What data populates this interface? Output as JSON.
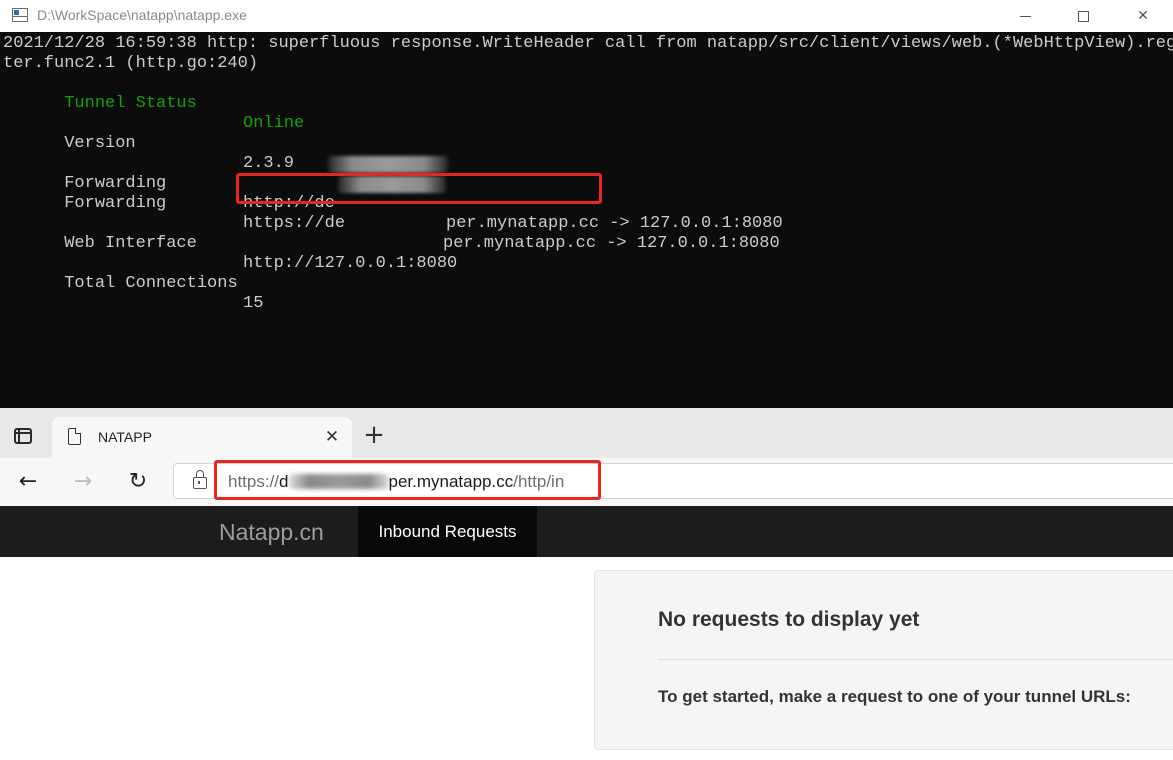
{
  "console": {
    "title": "D:\\WorkSpace\\natapp\\natapp.exe",
    "log_line1": "2021/12/28 16:59:38 http: superfluous response.WriteHeader call from natapp/src/client/views/web.(*WebHttpView).regis",
    "log_line2": "ter.func2.1 (http.go:240)",
    "rows": [
      {
        "label": "Tunnel Status",
        "value": "Online"
      },
      {
        "label": "Version",
        "value": "2.3.9"
      },
      {
        "label": "Forwarding",
        "value_start": "http://de",
        "value_end": "per.mynatapp.cc -> 127.0.0.1:8080"
      },
      {
        "label": "Forwarding",
        "value_start": "https://de",
        "value_end": "per.mynatapp.cc -> 127.0.0.1:8080"
      },
      {
        "label": "Web Interface",
        "value": "http://127.0.0.1:8080"
      },
      {
        "label": "Total Connections",
        "value": "15"
      }
    ],
    "status_color": "#13a10e",
    "highlight_color": "#e8251f"
  },
  "browser": {
    "tab": {
      "title": "NATAPP"
    },
    "address": {
      "url_prefix": "https://",
      "url_host_start": "d",
      "url_host_end": "per.mynatapp.cc",
      "url_path": "/http/in"
    },
    "site": {
      "brand": "Natapp.cn",
      "nav_active": "Inbound Requests"
    },
    "panel": {
      "title": "No requests to display yet",
      "instruction": "To get started, make a request to one of your tunnel URLs:"
    }
  },
  "icons": {
    "app": "console-app-icon",
    "minimize": "minimize-icon",
    "maximize": "maximize-icon",
    "close": "close-icon",
    "tab_actions": "tab-actions-icon",
    "page": "page-icon",
    "new_tab": "plus-icon",
    "back": "arrow-left-icon",
    "forward": "arrow-right-icon",
    "refresh": "refresh-icon",
    "lock": "lock-icon"
  }
}
